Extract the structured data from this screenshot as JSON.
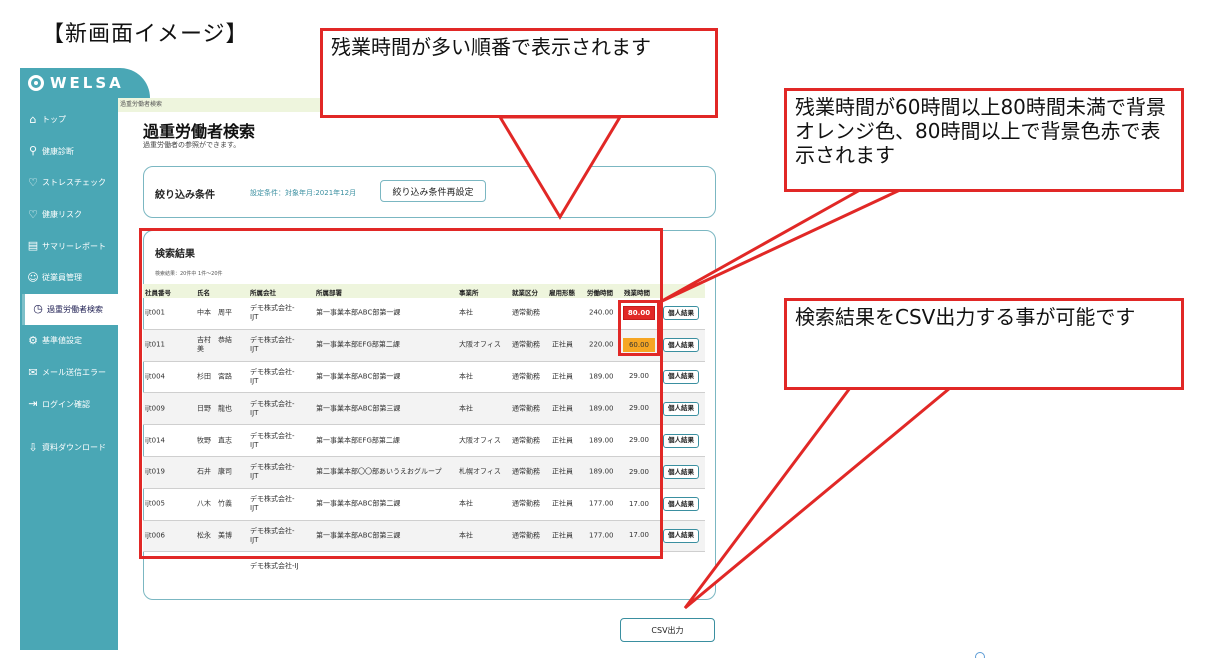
{
  "page_heading": "【新画面イメージ】",
  "sidebar": {
    "logo": "WELSA",
    "items": [
      {
        "icon": "home-icon",
        "glyph": "⌂",
        "label": "トップ"
      },
      {
        "icon": "search-icon",
        "glyph": "⚲",
        "label": "健康診断"
      },
      {
        "icon": "heart-icon",
        "glyph": "♡",
        "label": "ストレスチェック"
      },
      {
        "icon": "heart-pulse-icon",
        "glyph": "♡",
        "label": "健康リスク"
      },
      {
        "icon": "document-icon",
        "glyph": "▤",
        "label": "サマリーレポート"
      },
      {
        "icon": "person-icon",
        "glyph": "☺",
        "label": "従業員管理"
      },
      {
        "icon": "clock-icon",
        "glyph": "◷",
        "label": "過重労働者検索"
      },
      {
        "icon": "gear-icon",
        "glyph": "⚙",
        "label": "基準値設定"
      },
      {
        "icon": "mail-icon",
        "glyph": "✉",
        "label": "メール送信エラー"
      },
      {
        "icon": "login-icon",
        "glyph": "⇥",
        "label": "ログイン確認"
      },
      {
        "icon": "download-icon",
        "glyph": "⇩",
        "label": "資料ダウンロード"
      }
    ]
  },
  "main": {
    "breadcrumb": "過重労働者検索",
    "title": "過重労働者検索",
    "subtitle": "過重労働者の参照ができます。",
    "filter": {
      "label": "絞り込み条件",
      "condition": "設定条件：対象年月:2021年12月",
      "reset_button": "絞り込み条件再設定"
    },
    "results": {
      "title": "検索結果",
      "count": "検索結果：20件中 1件～20件",
      "columns": [
        "社員番号",
        "氏名",
        "所属会社",
        "所属部署",
        "事業所",
        "就業区分",
        "雇用形態",
        "労働時間",
        "残業時間"
      ],
      "detail_label": "個人結果",
      "rows": [
        {
          "id": "ijt001",
          "name": "中本　周平",
          "company": "デモ株式会社-IJT",
          "dept": "第一事業本部ABC部第一課",
          "office": "本社",
          "work_type": "通常勤務",
          "employment": "",
          "hours": "240.00",
          "overtime": "80.00",
          "level": "red"
        },
        {
          "id": "ijt011",
          "name": "吉村　恭結美",
          "company": "デモ株式会社-IJT",
          "dept": "第一事業本部EFG部第二課",
          "office": "大阪オフィス",
          "work_type": "通常勤務",
          "employment": "正社員",
          "hours": "220.00",
          "overtime": "60.00",
          "level": "orange"
        },
        {
          "id": "ijt004",
          "name": "杉田　宮路",
          "company": "デモ株式会社-IJT",
          "dept": "第一事業本部ABC部第一課",
          "office": "本社",
          "work_type": "通常勤務",
          "employment": "正社員",
          "hours": "189.00",
          "overtime": "29.00",
          "level": ""
        },
        {
          "id": "ijt009",
          "name": "日野　龍也",
          "company": "デモ株式会社-IJT",
          "dept": "第一事業本部ABC部第三課",
          "office": "本社",
          "work_type": "通常勤務",
          "employment": "正社員",
          "hours": "189.00",
          "overtime": "29.00",
          "level": ""
        },
        {
          "id": "ijt014",
          "name": "牧野　直志",
          "company": "デモ株式会社-IJT",
          "dept": "第一事業本部EFG部第二課",
          "office": "大阪オフィス",
          "work_type": "通常勤務",
          "employment": "正社員",
          "hours": "189.00",
          "overtime": "29.00",
          "level": ""
        },
        {
          "id": "ijt019",
          "name": "石井　康司",
          "company": "デモ株式会社-IJT",
          "dept": "第二事業本部〇〇部あいうえおグループ",
          "office": "札幌オフィス",
          "work_type": "通常勤務",
          "employment": "正社員",
          "hours": "189.00",
          "overtime": "29.00",
          "level": ""
        },
        {
          "id": "ijt005",
          "name": "八木　竹義",
          "company": "デモ株式会社-IJT",
          "dept": "第一事業本部ABC部第二課",
          "office": "本社",
          "work_type": "通常勤務",
          "employment": "正社員",
          "hours": "177.00",
          "overtime": "17.00",
          "level": ""
        },
        {
          "id": "ijt006",
          "name": "松永　美博",
          "company": "デモ株式会社-IJT",
          "dept": "第一事業本部ABC部第三課",
          "office": "本社",
          "work_type": "通常勤務",
          "employment": "正社員",
          "hours": "177.00",
          "overtime": "17.00",
          "level": ""
        }
      ],
      "partial_row_company": "デモ株式会社-IJ"
    },
    "csv_button": "CSV出力"
  },
  "callouts": {
    "sort_order": "残業時間が多い順番で表示されます",
    "color_rule": "残業時間が60時間以上80時間未満で背景オレンジ色、80時間以上で背景色赤で表示されます",
    "csv_export": "検索結果をCSV出力する事が可能です"
  },
  "colors": {
    "sidebar": "#4aa7b5",
    "highlight_frame": "#e12826",
    "overtime_red": "#e12826",
    "overtime_orange": "#f6a623",
    "header_band": "#eef5dd"
  }
}
